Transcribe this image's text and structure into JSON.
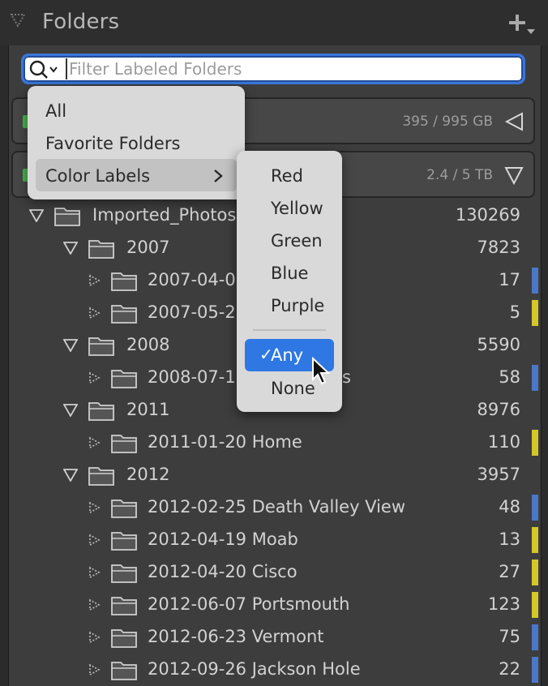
{
  "header": {
    "title": "Folders"
  },
  "search": {
    "placeholder": "Filter Labeled Folders",
    "value": ""
  },
  "volumes": [
    {
      "size": "395 / 995 GB",
      "expanded": false
    },
    {
      "size": "2.4 / 5 TB",
      "expanded": true
    }
  ],
  "tree": [
    {
      "name": "Imported_Photos",
      "count": "130269",
      "level": 0,
      "expanded": true,
      "label": ""
    },
    {
      "name": "2007",
      "count": "7823",
      "level": 1,
      "expanded": true,
      "label": ""
    },
    {
      "name": "2007-04-0",
      "count": "17",
      "level": 2,
      "label": "#4a78c9"
    },
    {
      "name": "2007-05-2",
      "count": "5",
      "level": 2,
      "label": "#d4c829"
    },
    {
      "name": "2008",
      "count": "5590",
      "level": 1,
      "expanded": true,
      "label": ""
    },
    {
      "name": "2008-07-1",
      "name_tail": "s",
      "count": "58",
      "level": 2,
      "label": "#4a78c9"
    },
    {
      "name": "2011",
      "count": "8976",
      "level": 1,
      "expanded": true,
      "label": ""
    },
    {
      "name": "2011-01-20 Home",
      "count": "110",
      "level": 2,
      "label": "#d4c829"
    },
    {
      "name": "2012",
      "count": "3957",
      "level": 1,
      "expanded": true,
      "label": ""
    },
    {
      "name": "2012-02-25 Death Valley View",
      "count": "48",
      "level": 2,
      "label": "#4a78c9"
    },
    {
      "name": "2012-04-19 Moab",
      "count": "13",
      "level": 2,
      "label": "#d4c829"
    },
    {
      "name": "2012-04-20 Cisco",
      "count": "27",
      "level": 2,
      "label": "#d4c829"
    },
    {
      "name": "2012-06-07 Portsmouth",
      "count": "123",
      "level": 2,
      "label": "#d4c829"
    },
    {
      "name": "2012-06-23 Vermont",
      "count": "75",
      "level": 2,
      "label": "#4a78c9"
    },
    {
      "name": "2012-09-26 Jackson Hole",
      "count": "22",
      "level": 2,
      "label": "#4a78c9"
    }
  ],
  "filter_menu": {
    "items": [
      "All",
      "Favorite Folders",
      "Color Labels"
    ],
    "highlighted": "Color Labels"
  },
  "color_menu": {
    "items": [
      "Red",
      "Yellow",
      "Green",
      "Blue",
      "Purple"
    ],
    "selected": "Any",
    "selected_mark": "✓",
    "after": [
      "None"
    ]
  },
  "colors": {
    "accent": "#2f78e3",
    "label_blue": "#4a78c9",
    "label_yellow": "#d4c829",
    "volume_green": "#47b34a"
  }
}
